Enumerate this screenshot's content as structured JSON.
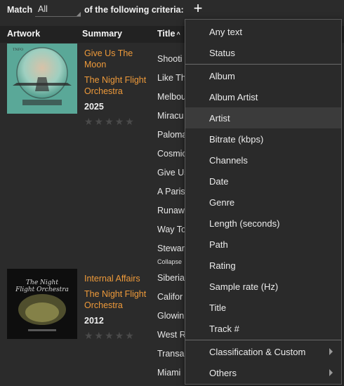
{
  "toolbar": {
    "match_label": "Match",
    "match_value": "All",
    "criteria_text": "of the following criteria:",
    "add_icon": "plus-icon",
    "add_symbol": "+"
  },
  "columns": {
    "artwork": "Artwork",
    "summary": "Summary",
    "title": "Title",
    "title_sort_icon": "sort-ascending-icon",
    "title_sort_symbol": "^"
  },
  "albums": [
    {
      "title": "Give Us The Moon",
      "artist": "The Night Flight Orchestra",
      "year": "2025",
      "rating": 0,
      "stars": "★★★★★"
    },
    {
      "title": "Internal Affairs",
      "artist": "The Night Flight Orchestra",
      "year": "2012",
      "rating": 0,
      "stars": "★★★★★"
    }
  ],
  "tracks": [
    "Shooti",
    "Like Th",
    "Melbou",
    "Miracu",
    "Paloma",
    "Cosmic",
    "Give Us",
    "A Paris",
    "Runaw",
    "Way To",
    "Stewar",
    "Siberia",
    "Califor",
    "Glowin",
    "West R",
    "Transa",
    "Miami"
  ],
  "collapse_label": "Collapse",
  "menu": {
    "group1": [
      "Any text",
      "Status"
    ],
    "group2": [
      "Album",
      "Album Artist",
      "Artist",
      "Bitrate (kbps)",
      "Channels",
      "Date",
      "Genre",
      "Length (seconds)",
      "Path",
      "Rating",
      "Sample rate (Hz)",
      "Title",
      "Track #"
    ],
    "group3": [
      "Classification & Custom",
      "Others"
    ],
    "hovered": "Artist",
    "submenu_icon": "chevron-right-icon"
  },
  "colors": {
    "accent": "#ee9a3a",
    "background": "#2b2b2b",
    "header": "#222222",
    "menu_hover": "#3b3b3b"
  }
}
